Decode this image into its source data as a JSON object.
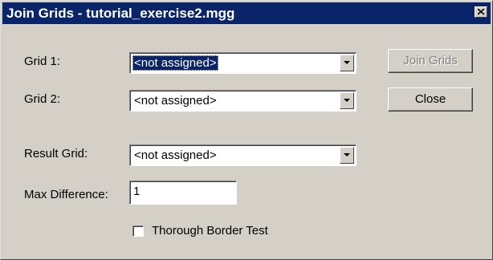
{
  "window": {
    "title": "Join Grids - tutorial_exercise2.mgg",
    "close_icon": "close-x-icon",
    "colors": {
      "titlebar": "#0a246a",
      "face": "#d4d0c8",
      "title_text": "#ffffff"
    }
  },
  "form": {
    "grid1": {
      "label": "Grid 1:",
      "value": "<not assigned>",
      "selected": true
    },
    "grid2": {
      "label": "Grid 2:",
      "value": "<not assigned>"
    },
    "result_grid": {
      "label": "Result Grid:",
      "value": "<not assigned>"
    },
    "max_difference": {
      "label": "Max Difference:",
      "value": "1"
    },
    "thorough_border_test": {
      "label": "Thorough Border Test",
      "checked": false
    }
  },
  "buttons": {
    "join_grids": {
      "label": "Join Grids",
      "enabled": false
    },
    "close": {
      "label": "Close",
      "enabled": true
    }
  },
  "icons": {
    "dropdown": "chevron-down-icon",
    "checkbox": "checkbox-unchecked"
  }
}
